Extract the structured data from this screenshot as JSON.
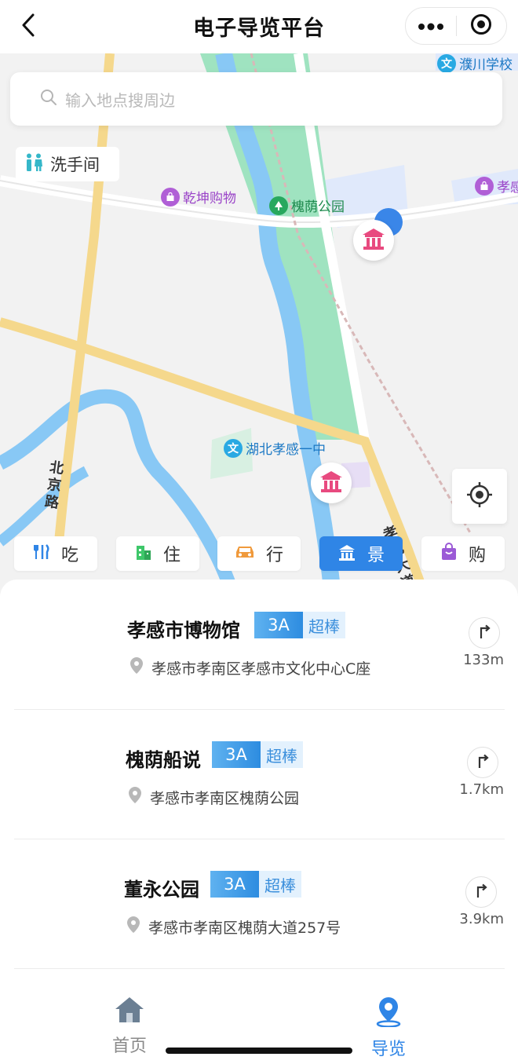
{
  "header": {
    "title": "电子导览平台",
    "back_icon": "chevron-left-icon",
    "more_icon": "more-dots-icon",
    "close_icon": "target-circle-icon"
  },
  "search": {
    "placeholder": "输入地点搜周边"
  },
  "restroom_button": {
    "label": "洗手间"
  },
  "map": {
    "pois": [
      {
        "label": "濮川学校",
        "icon": "文"
      },
      {
        "label": "乾坤购物"
      },
      {
        "label": "槐荫公园"
      },
      {
        "label": "湖北孝感一中",
        "icon": "文"
      },
      {
        "label": "孝感"
      }
    ],
    "roads": {
      "beijing_road": "北京路",
      "xiaowu_avenue": "孝武大道"
    },
    "colors": {
      "park": "#9fe3c0",
      "river": "#88c8f5",
      "road": "#f5d88c",
      "marker": "#e84a7f"
    }
  },
  "categories": [
    {
      "label": "吃",
      "icon": "food-icon",
      "active": false
    },
    {
      "label": "住",
      "icon": "hotel-icon",
      "active": false
    },
    {
      "label": "行",
      "icon": "car-icon",
      "active": false
    },
    {
      "label": "景",
      "icon": "scenic-icon",
      "active": true
    },
    {
      "label": "购",
      "icon": "shopping-icon",
      "active": false
    }
  ],
  "places": [
    {
      "name": "孝感市博物馆",
      "level": "3A",
      "tag": "超棒",
      "address": "孝感市孝南区孝感市文化中心C座",
      "distance": "133m"
    },
    {
      "name": "槐荫船说",
      "level": "3A",
      "tag": "超棒",
      "address": "孝感市孝南区槐荫公园",
      "distance": "1.7km"
    },
    {
      "name": "董永公园",
      "level": "3A",
      "tag": "超棒",
      "address": "孝感市孝南区槐荫大道257号",
      "distance": "3.9km"
    }
  ],
  "tabbar": {
    "home": {
      "label": "首页",
      "color": "#8a8a8a"
    },
    "guide": {
      "label": "导览",
      "color": "#2f85e6",
      "active": true
    }
  }
}
